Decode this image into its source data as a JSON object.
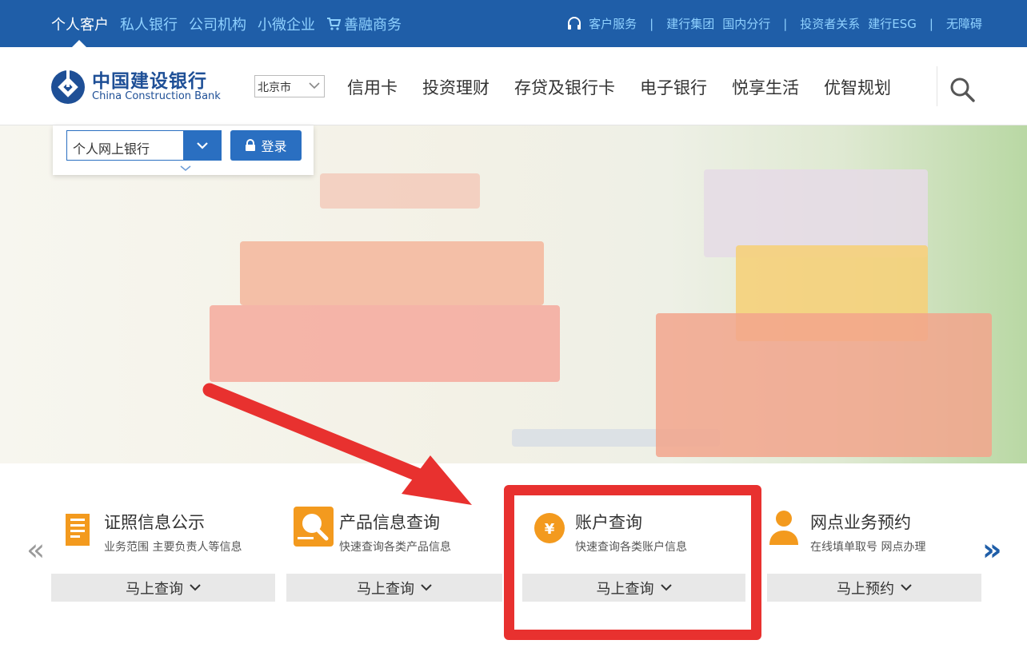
{
  "topbar": {
    "left_links": [
      "个人客户",
      "私人银行",
      "公司机构",
      "小微企业",
      "善融商务"
    ],
    "active_index": 0,
    "right_links": [
      "客户服务",
      "建行集团",
      "国内分行",
      "投资者关系",
      "建行ESG",
      "无障碍"
    ]
  },
  "header": {
    "logo_cn": "中国建设银行",
    "logo_en": "China Construction Bank",
    "city_selected": "北京市",
    "nav": [
      "信用卡",
      "投资理财",
      "存贷及银行卡",
      "电子银行",
      "悦享生活",
      "优智规划"
    ]
  },
  "login": {
    "select_value": "个人网上银行",
    "login_label": "登录"
  },
  "services": [
    {
      "title": "证照信息公示",
      "desc": "业务范围 主要负责人等信息",
      "button": "马上查询",
      "icon": "document-icon"
    },
    {
      "title": "产品信息查询",
      "desc": "快速查询各类产品信息",
      "button": "马上查询",
      "icon": "magnifier-icon"
    },
    {
      "title": "账户查询",
      "desc": "快速查询各类账户信息",
      "button": "马上查询",
      "icon": "yuan-icon"
    },
    {
      "title": "网点业务预约",
      "desc": "在线填单取号 网点办理",
      "button": "马上预约",
      "icon": "person-icon"
    }
  ],
  "colors": {
    "brand_blue": "#1f5ea8",
    "accent_orange": "#f39a1e",
    "annotation_red": "#e8312f"
  }
}
